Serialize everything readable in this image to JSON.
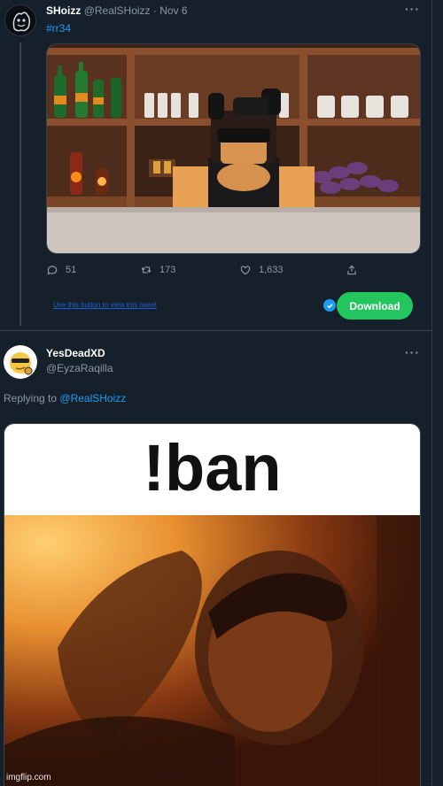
{
  "tweet1": {
    "display_name": "SHoizz",
    "handle": "@RealSHoizz",
    "sep": "·",
    "date": "Nov 6",
    "hashtag": "#rr34",
    "more": "···",
    "actions": {
      "replies": "51",
      "retweets": "173",
      "likes": "1,633"
    }
  },
  "extension_bar": {
    "link_text": "Use this button to view this tweet",
    "download_label": "Download",
    "accent": "#22c55e"
  },
  "reply": {
    "display_name": "YesDeadXD",
    "handle": "@EyzaRaqilla",
    "more": "···",
    "replying_to_prefix": "Replying to",
    "replying_to_handle": "@RealSHoizz"
  },
  "meme": {
    "caption": "!ban"
  },
  "watermark": "imgflip.com",
  "colors": {
    "background": "#15202b",
    "link": "#1d9bf0",
    "muted": "#8b98a5"
  }
}
